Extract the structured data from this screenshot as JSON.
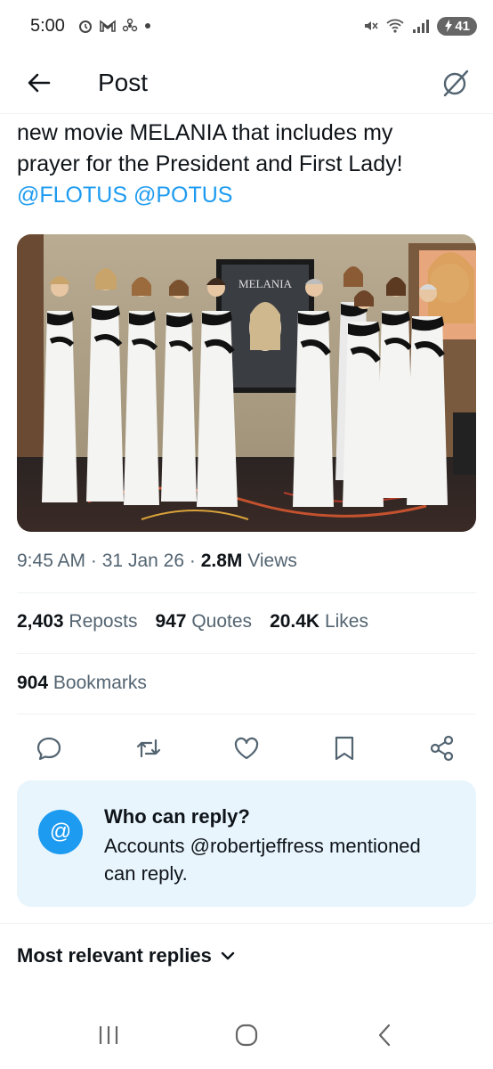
{
  "status_bar": {
    "time": "5:00",
    "battery": "41",
    "icons": [
      "alarm-icon",
      "gmail-icon",
      "fan-icon",
      "dot-icon",
      "mute-icon",
      "wifi-icon",
      "signal-icon",
      "battery-icon"
    ]
  },
  "header": {
    "title": "Post",
    "back_icon": "arrow-left-icon",
    "grok_icon": "grok-icon"
  },
  "tweet": {
    "text_line1": "new movie MELANIA that includes my",
    "text_line2": "prayer for the President and First Lady!",
    "mention1": "@FLOTUS",
    "mention2": "@POTUS",
    "poster_label": "MELANIA",
    "meta_time": "9:45 AM",
    "meta_sep1": "·",
    "meta_date": "31 Jan 26",
    "meta_sep2": "·",
    "views_count": "2.8M",
    "views_label": "Views"
  },
  "stats": {
    "reposts_count": "2,403",
    "reposts_label": "Reposts",
    "quotes_count": "947",
    "quotes_label": "Quotes",
    "likes_count": "20.4K",
    "likes_label": "Likes",
    "bookmarks_count": "904",
    "bookmarks_label": "Bookmarks"
  },
  "actions": [
    "reply-icon",
    "repost-icon",
    "like-icon",
    "bookmark-icon",
    "share-icon"
  ],
  "reply_box": {
    "icon_text": "@",
    "title": "Who can reply?",
    "desc_line1": "Accounts @robertjeffress mentioned",
    "desc_line2": "can reply."
  },
  "replies": {
    "sort_label": "Most relevant replies"
  },
  "colors": {
    "accent": "#1d9bf0",
    "text": "#0f1419",
    "secondary": "#536471",
    "reply_bg": "#e8f5fd"
  }
}
